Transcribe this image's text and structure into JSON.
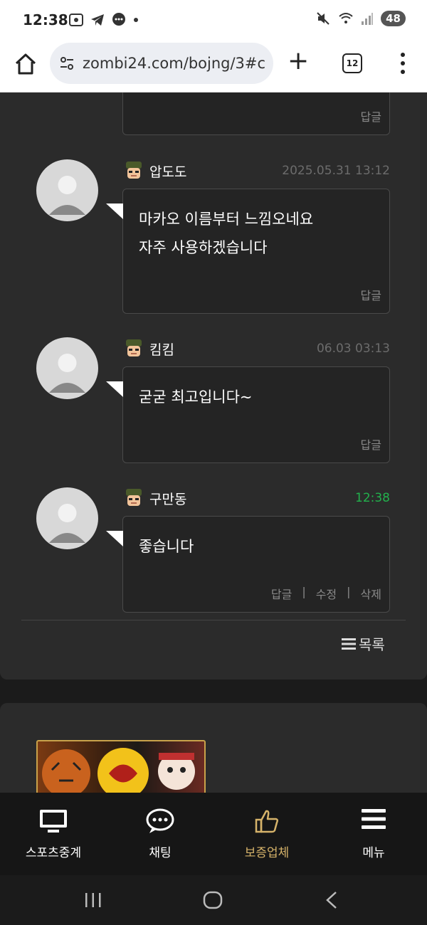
{
  "status": {
    "time": "12:38",
    "battery": "48"
  },
  "browser": {
    "url": "zombi24.com/bojng/3#c",
    "tab_count": "12"
  },
  "comments": [
    {
      "reply_label": "답글"
    },
    {
      "nick": "압도도",
      "date": "2025.05.31 13:12",
      "lines": [
        "마카오 이름부터 느낌오네요",
        "자주 사용하겠습니다"
      ],
      "reply_label": "답글"
    },
    {
      "nick": "킴킴",
      "date": "06.03 03:13",
      "lines": [
        "굳굳 최고입니다~"
      ],
      "reply_label": "답글"
    },
    {
      "nick": "구만동",
      "date": "12:38",
      "lines": [
        "좋습니다"
      ],
      "reply_label": "답글",
      "edit_label": "수정",
      "delete_label": "삭제",
      "separator": "|"
    }
  ],
  "list_button": {
    "label": "목록",
    "icon": "list-icon"
  },
  "bottom_nav": [
    {
      "label": "스포츠중계",
      "icon": "monitor-icon"
    },
    {
      "label": "채팅",
      "icon": "chat-bubble-icon"
    },
    {
      "label": "보증업체",
      "icon": "thumbs-up-icon"
    },
    {
      "label": "메뉴",
      "icon": "hamburger-menu-icon"
    }
  ],
  "colors": {
    "accent_gold": "#d6b36a",
    "timestamp_now": "#22b14c",
    "panel_bg": "#2b2b2b"
  }
}
